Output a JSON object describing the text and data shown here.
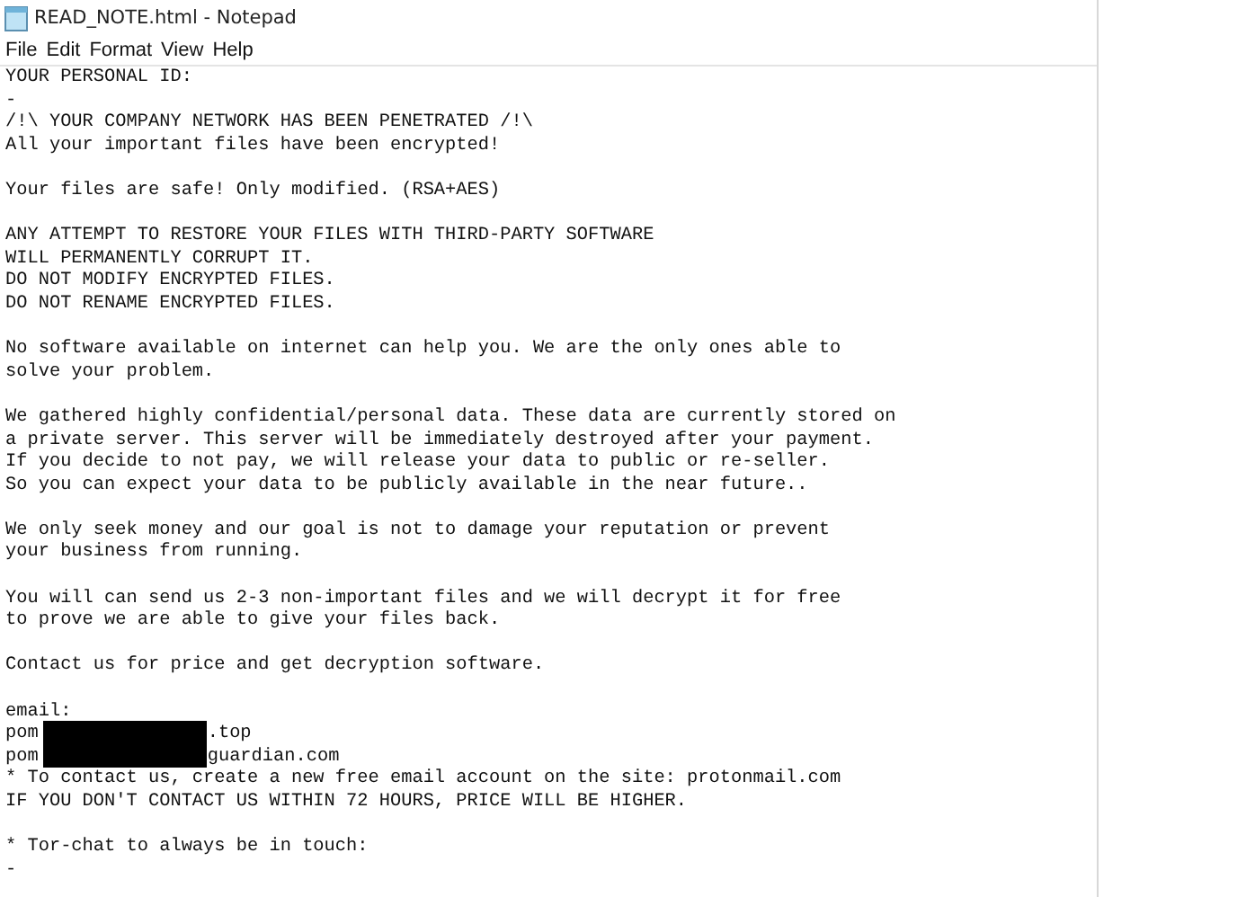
{
  "window": {
    "title": "READ_NOTE.html - Notepad"
  },
  "menu": [
    "File",
    "Edit",
    "Format",
    "View",
    "Help"
  ],
  "blocks": [
    {
      "kind": "plain",
      "lines": [
        "YOUR PERSONAL ID:",
        "-",
        "/!\\ YOUR COMPANY NETWORK HAS BEEN PENETRATED /!\\",
        "All your important files have been encrypted!"
      ]
    },
    {
      "kind": "plain",
      "lines": [
        "Your files are safe! Only modified. (RSA+AES)"
      ]
    },
    {
      "kind": "plain",
      "lines": [
        "ANY ATTEMPT TO RESTORE YOUR FILES WITH THIRD-PARTY SOFTWARE",
        "WILL PERMANENTLY CORRUPT IT.",
        "DO NOT MODIFY ENCRYPTED FILES.",
        "DO NOT RENAME ENCRYPTED FILES."
      ]
    },
    {
      "kind": "plain",
      "lines": [
        "No software available on internet can help you. We are the only ones able to",
        "solve your problem."
      ]
    },
    {
      "kind": "plain",
      "lines": [
        "We gathered highly confidential/personal data. These data are currently stored on",
        "a private server. This server will be immediately destroyed after your payment.",
        "If you decide to not pay, we will release your data to public or re-seller.",
        "So you can expect your data to be publicly available in the near future.."
      ]
    },
    {
      "kind": "plain",
      "lines": [
        "We only seek money and our goal is not to damage your reputation or prevent",
        "your business from running."
      ]
    },
    {
      "kind": "plain",
      "lines": [
        "You will can send us 2-3 non-important files and we will decrypt it for free",
        "to prove we are able to give your files back."
      ]
    },
    {
      "kind": "plain",
      "lines": [
        "Contact us for price and get decryption software."
      ]
    },
    {
      "kind": "email",
      "label": "email:",
      "addresses": [
        {
          "start": "pom",
          "end": ".top"
        },
        {
          "start": "pom",
          "end": "guardian.com"
        }
      ],
      "lines": [
        "* To contact us, create a new free email account on the site: protonmail.com",
        "IF YOU DON'T CONTACT US WITHIN 72 HOURS, PRICE WILL BE HIGHER."
      ]
    },
    {
      "kind": "plain",
      "lines": [
        "* Tor-chat to always be in touch:",
        "-"
      ]
    }
  ]
}
